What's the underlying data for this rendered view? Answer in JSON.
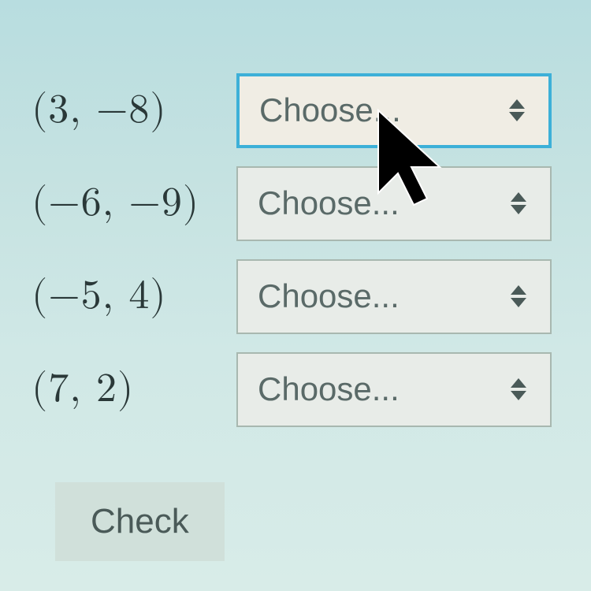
{
  "rows": [
    {
      "label": "(3, −8)",
      "dropdown": "Choose...",
      "focused": true
    },
    {
      "label": "(−6, −9)",
      "dropdown": "Choose...",
      "focused": false
    },
    {
      "label": "(−5, 4)",
      "dropdown": "Choose...",
      "focused": false
    },
    {
      "label": "(7, 2)",
      "dropdown": "Choose...",
      "focused": false
    }
  ],
  "check_button": "Check"
}
